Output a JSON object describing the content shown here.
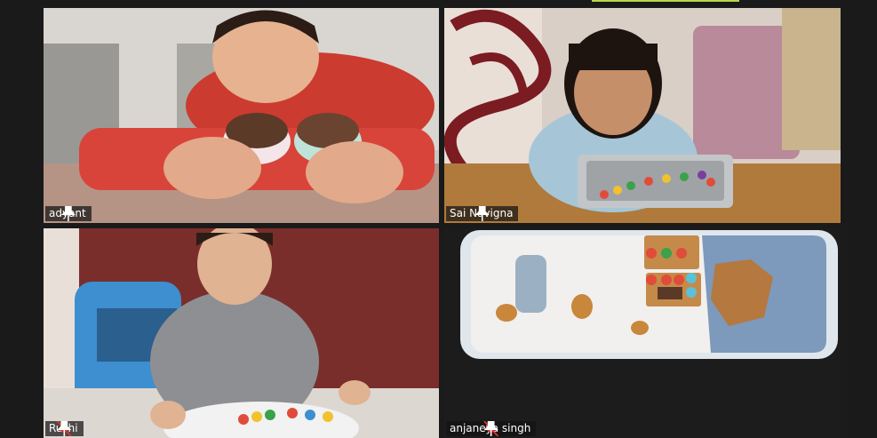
{
  "meeting": {
    "participants": [
      {
        "name": "adyant",
        "muted": false
      },
      {
        "name": "Sai Navigna",
        "muted": false
      },
      {
        "name": "Rushi",
        "muted": true
      },
      {
        "name": "anjaneya singh",
        "muted": true
      }
    ]
  },
  "colors": {
    "background": "#1a1a1a",
    "active_speaker_strip": "#b9d34a",
    "name_tag_bg": "#141414",
    "muted_icon": "#e0302d"
  },
  "icons": [
    "pin-icon",
    "mic-muted-icon"
  ]
}
